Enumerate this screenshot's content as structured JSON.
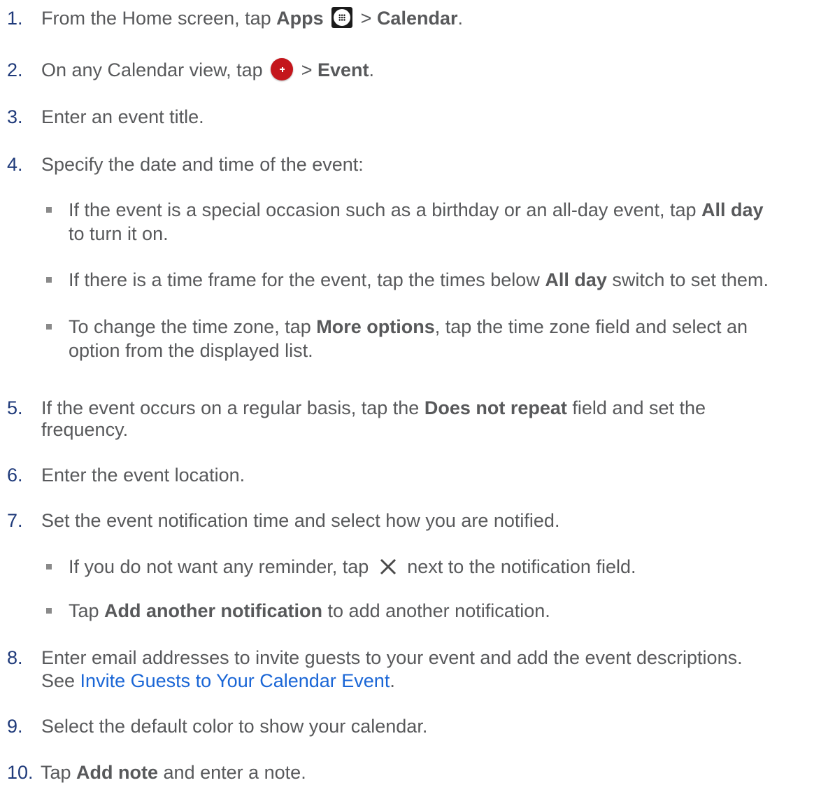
{
  "steps": [
    {
      "num": "1.",
      "pre": "From the Home screen, tap ",
      "b1": "Apps",
      "mid": " > ",
      "b2": "Calendar",
      "post": "."
    },
    {
      "num": "2.",
      "pre": "On any Calendar view, tap ",
      "mid": " > ",
      "b1": "Event",
      "post": "."
    },
    {
      "num": "3.",
      "text": "Enter an event title."
    },
    {
      "num": "4.",
      "text": "Specify the date and time of the event:"
    },
    {
      "num": "5.",
      "pre": "If the event occurs on a regular basis, tap the ",
      "b1": "Does not repeat",
      "post": " field and set the",
      "line2": "frequency."
    },
    {
      "num": "6.",
      "text": "Enter the event location."
    },
    {
      "num": "7.",
      "text": "Set the event notification time and select how you are notified."
    },
    {
      "num": "8.",
      "line1": "Enter email addresses to invite guests to your event and add the event descriptions.",
      "pre2": "See ",
      "link": "Invite Guests to Your Calendar Event",
      "post2": "."
    },
    {
      "num": "9.",
      "text": "Select the default color to show your calendar."
    },
    {
      "num": "10.",
      "pre": "Tap ",
      "b1": "Add note",
      "post": " and enter a note."
    }
  ],
  "sub4": [
    {
      "pre": "If the event is a special occasion such as a birthday or an all-day event, tap ",
      "b1": "All day",
      "line2": "to turn it on."
    },
    {
      "pre": "If there is a time frame for the event, tap the times below ",
      "b1": "All day",
      "post": " switch to set them."
    },
    {
      "pre": "To change the time zone, tap ",
      "b1": "More options",
      "post": ", tap the time zone field and select an",
      "line2": "option from the displayed list."
    }
  ],
  "sub7": [
    {
      "pre": "If you do not want any reminder, tap ",
      "post": " next to the notification field."
    },
    {
      "pre": "Tap ",
      "b1": "Add another notification",
      "post": " to add another notification."
    }
  ],
  "icons": {
    "apps": "apps-grid-icon",
    "add": "add-circle-icon",
    "close": "close-x-icon"
  },
  "colors": {
    "text": "#58595b",
    "number": "#1f3a7a",
    "link": "#1a66d6",
    "add_button": "#c4161c"
  }
}
